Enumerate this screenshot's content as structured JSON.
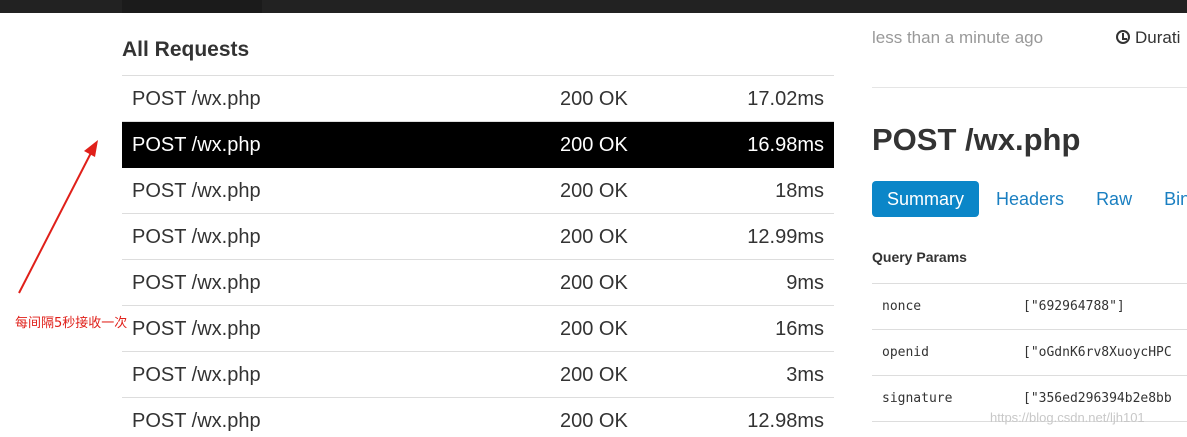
{
  "requests": {
    "heading": "All Requests",
    "rows": [
      {
        "path": "POST /wx.php",
        "status": "200 OK",
        "duration": "17.02ms"
      },
      {
        "path": "POST /wx.php",
        "status": "200 OK",
        "duration": "16.98ms"
      },
      {
        "path": "POST /wx.php",
        "status": "200 OK",
        "duration": "18ms"
      },
      {
        "path": "POST /wx.php",
        "status": "200 OK",
        "duration": "12.99ms"
      },
      {
        "path": "POST /wx.php",
        "status": "200 OK",
        "duration": "9ms"
      },
      {
        "path": "POST /wx.php",
        "status": "200 OK",
        "duration": "16ms"
      },
      {
        "path": "POST /wx.php",
        "status": "200 OK",
        "duration": "3ms"
      },
      {
        "path": "POST /wx.php",
        "status": "200 OK",
        "duration": "12.98ms"
      }
    ]
  },
  "annotation": {
    "text": "每间隔5秒接收一次",
    "color": "#e0201a"
  },
  "detail": {
    "time_ago": "less than a minute ago",
    "duration_label": "Durati",
    "duration_icon": "clock-icon",
    "title": "POST /wx.php",
    "tabs": [
      {
        "label": "Summary",
        "active": true
      },
      {
        "label": "Headers",
        "active": false
      },
      {
        "label": "Raw",
        "active": false
      },
      {
        "label": "Bin",
        "active": false
      }
    ],
    "query_params_title": "Query Params",
    "params": [
      {
        "key": "nonce",
        "value": "[\"692964788\"]"
      },
      {
        "key": "openid",
        "value": "[\"oGdnK6rv8XuoycHPC"
      },
      {
        "key": "signature",
        "value": "[\"356ed296394b2e8bb"
      }
    ]
  },
  "watermark": "https://blog.csdn.net/ljh101",
  "colors": {
    "selected_row_bg": "#000000",
    "accent": "#0b86c8",
    "link": "#1a7fc1"
  }
}
